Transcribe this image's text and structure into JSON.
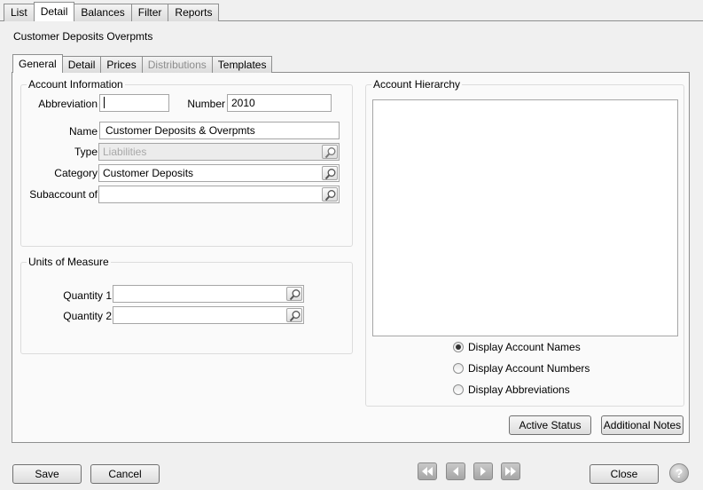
{
  "top_tabs": [
    "List",
    "Detail",
    "Balances",
    "Filter",
    "Reports"
  ],
  "panel_title": "Customer Deposits  Overpmts",
  "inner_tabs": [
    "General",
    "Detail",
    "Prices",
    "Distributions",
    "Templates"
  ],
  "account_info": {
    "title": "Account Information",
    "abbreviation_label": "Abbreviation",
    "abbreviation_value": "",
    "number_label": "Number",
    "number_value": "2010",
    "name_label": "Name",
    "name_value": "Customer Deposits & Overpmts",
    "type_label": "Type",
    "type_value": "Liabilities",
    "category_label": "Category",
    "category_value": "Customer Deposits",
    "subaccount_label": "Subaccount of",
    "subaccount_value": ""
  },
  "units": {
    "title": "Units of Measure",
    "quantity1_label": "Quantity 1",
    "quantity1_value": "",
    "quantity2_label": "Quantity 2",
    "quantity2_value": ""
  },
  "hierarchy": {
    "title": "Account Hierarchy",
    "options": [
      "Display Account Names",
      "Display Account Numbers",
      "Display Abbreviations"
    ],
    "selected": "Display Account Names"
  },
  "buttons": {
    "active_status": "Active Status",
    "additional_notes": "Additional Notes",
    "save": "Save",
    "cancel": "Cancel",
    "close": "Close",
    "help": "?"
  },
  "icons": {
    "lookup": "magnifier-icon",
    "first": "first-record-icon",
    "prev": "previous-record-icon",
    "next": "next-record-icon",
    "last": "last-record-icon",
    "help": "help-icon"
  }
}
